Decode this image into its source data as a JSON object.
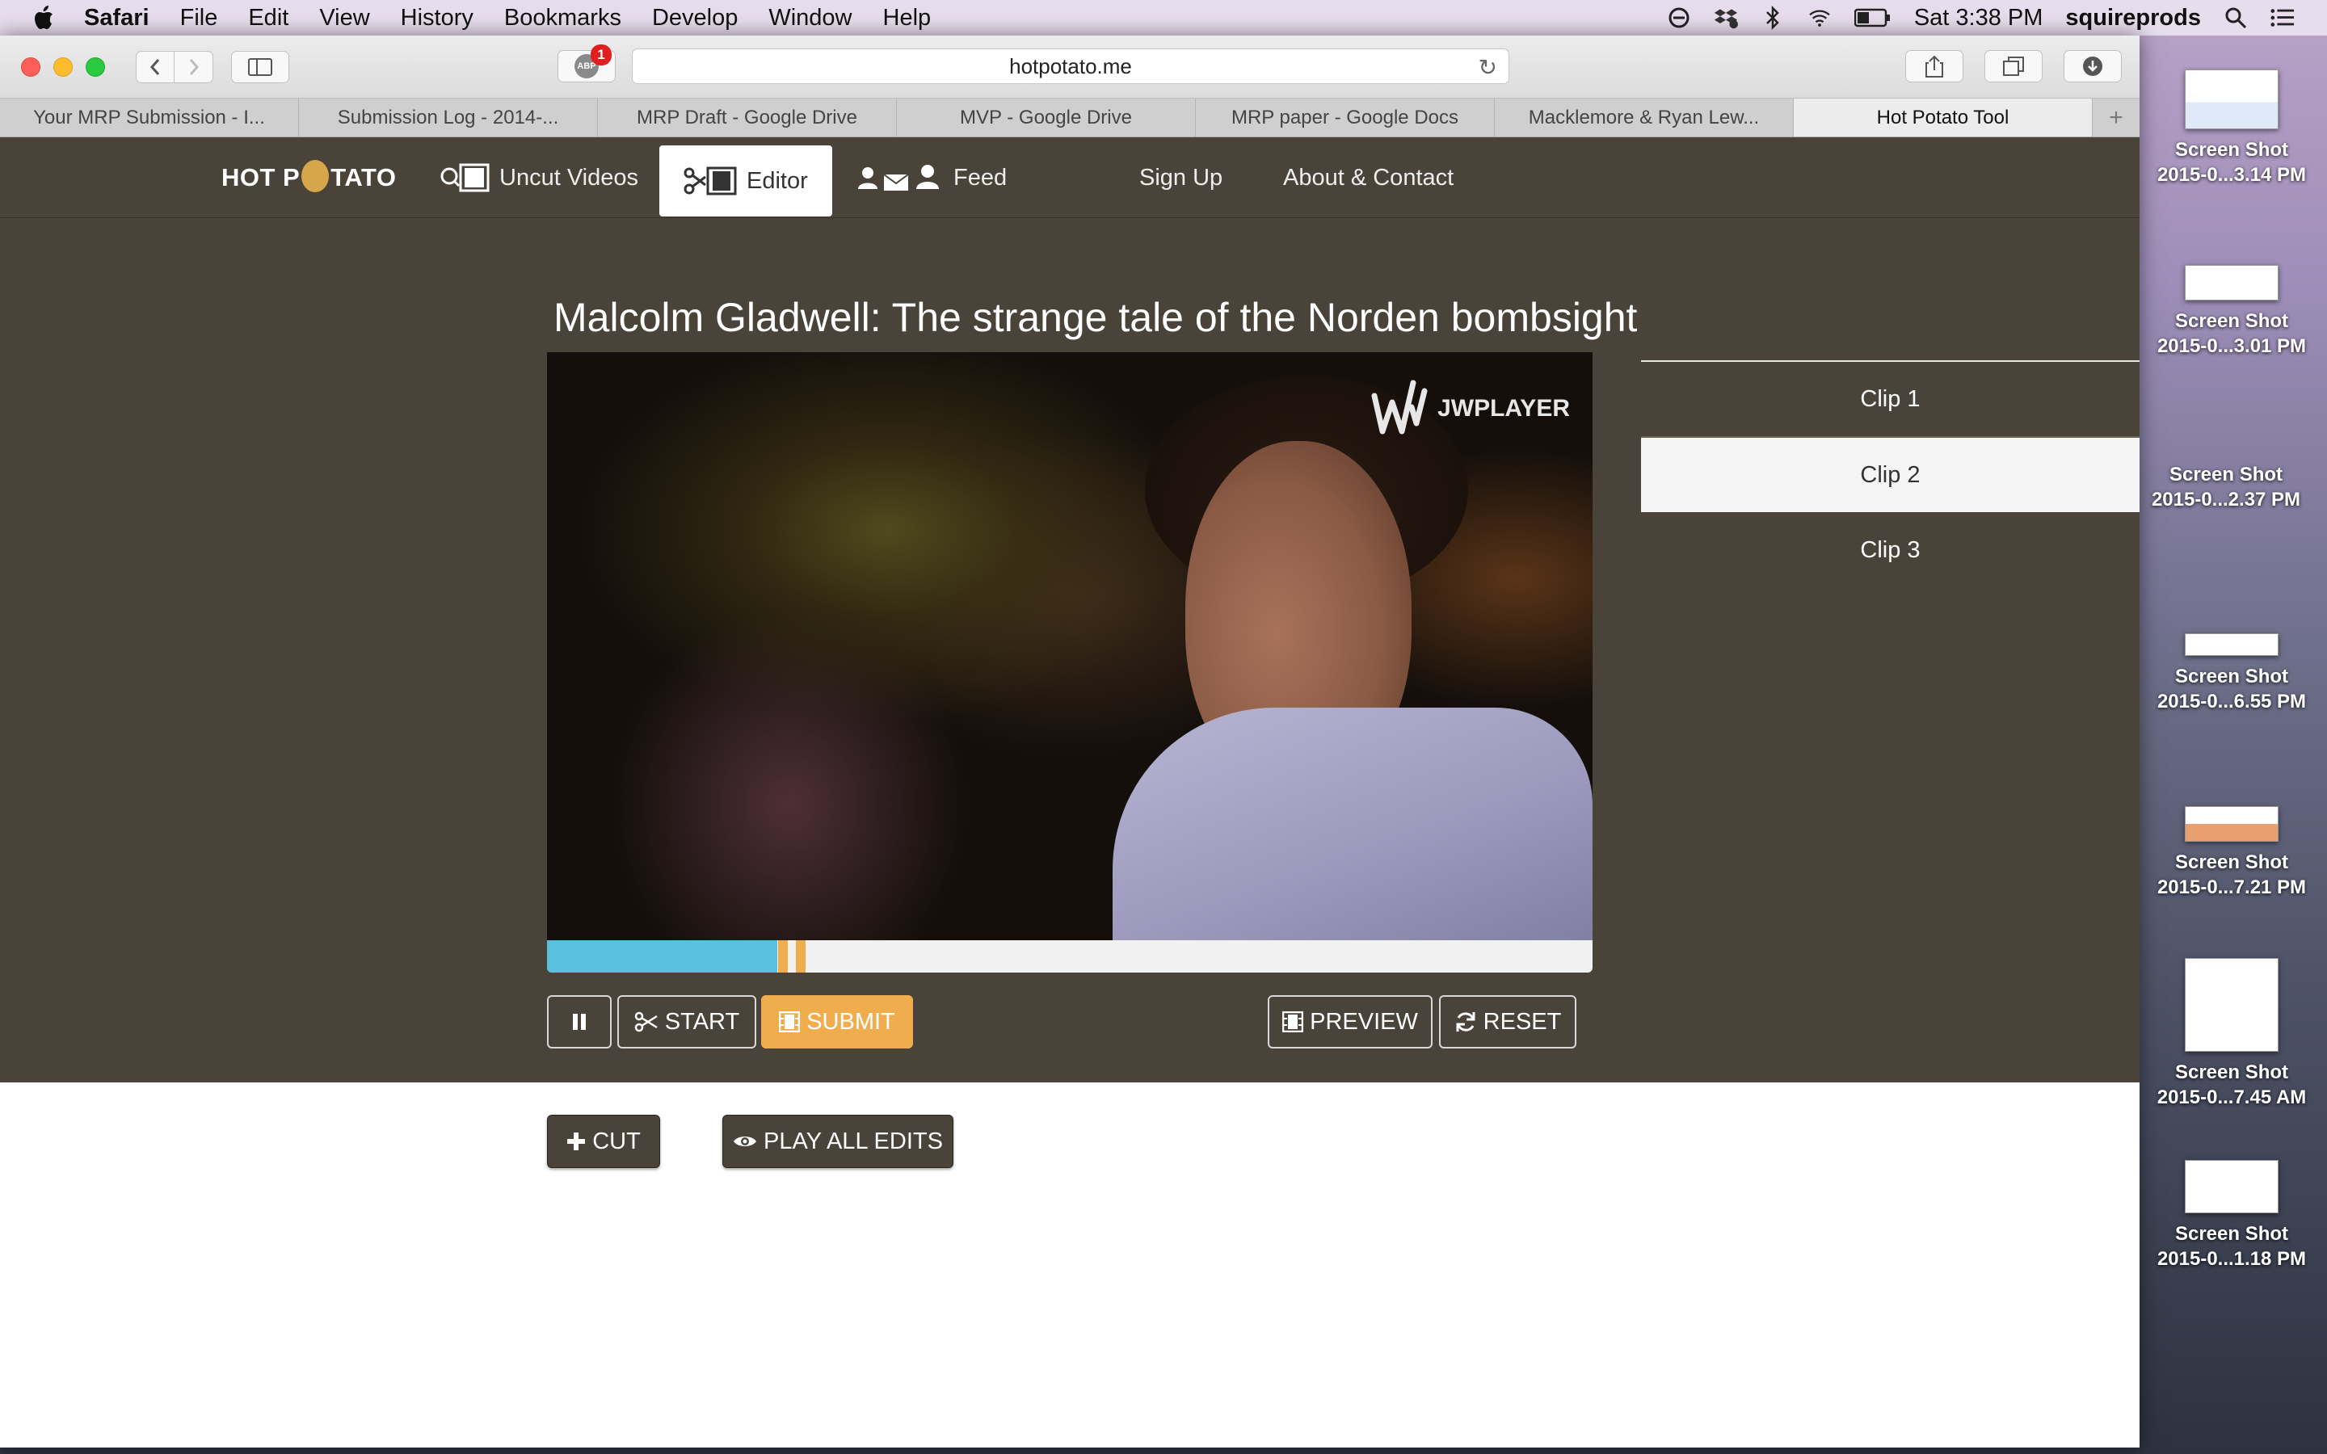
{
  "menubar": {
    "app": "Safari",
    "items": [
      "File",
      "Edit",
      "View",
      "History",
      "Bookmarks",
      "Develop",
      "Window",
      "Help"
    ],
    "clock": "Sat 3:38 PM",
    "user": "squireprods"
  },
  "browser": {
    "url": "hotpotato.me",
    "adblock_label": "ABP",
    "adblock_count": "1",
    "tabs": [
      {
        "label": "Your MRP Submission - I..."
      },
      {
        "label": "Submission Log - 2014-..."
      },
      {
        "label": "MRP Draft - Google Drive"
      },
      {
        "label": "MVP - Google Drive"
      },
      {
        "label": "MRP paper - Google Docs"
      },
      {
        "label": "Macklemore & Ryan Lew..."
      },
      {
        "label": "Hot Potato Tool"
      }
    ]
  },
  "site": {
    "logo_left": "HOT P",
    "logo_right": "TATO",
    "nav": {
      "uncut": "Uncut Videos",
      "editor": "Editor",
      "feed": "Feed",
      "signup": "Sign Up",
      "about": "About & Contact"
    },
    "video_title": "Malcolm Gladwell: The strange tale of the Norden bombsight",
    "player_brand": "JWPLAYER",
    "progress": {
      "played_fraction": 0.22,
      "markers": [
        0.221,
        0.238
      ]
    },
    "buttons": {
      "start": "START",
      "submit": "SUBMIT",
      "preview": "PREVIEW",
      "reset": "RESET",
      "cut": "CUT",
      "play_all": "PLAY ALL EDITS"
    },
    "clips": [
      "Clip 1",
      "Clip 2",
      "Clip 3"
    ],
    "active_clip_index": 1
  },
  "desktop": {
    "icons": [
      {
        "line1": "Screen Shot",
        "line2": "2015-0...3.14 PM"
      },
      {
        "line1": "Screen Shot",
        "line2": "2015-0...3.01 PM"
      },
      {
        "line1": "Screen Shot",
        "line2": "2015-0...2.37 PM"
      },
      {
        "line1": "Screen Shot",
        "line2": "2015-0...6.55 PM"
      },
      {
        "line1": "Screen Shot",
        "line2": "2015-0...7.21 PM"
      },
      {
        "line1": "Screen Shot",
        "line2": "2015-0...7.45 AM"
      },
      {
        "line1": "Screen Shot",
        "line2": "2015-0...1.18 PM"
      }
    ]
  },
  "colors": {
    "site_bg": "#4a4339",
    "accent_orange": "#f0ad4e",
    "progress_blue": "#5bc0de"
  }
}
